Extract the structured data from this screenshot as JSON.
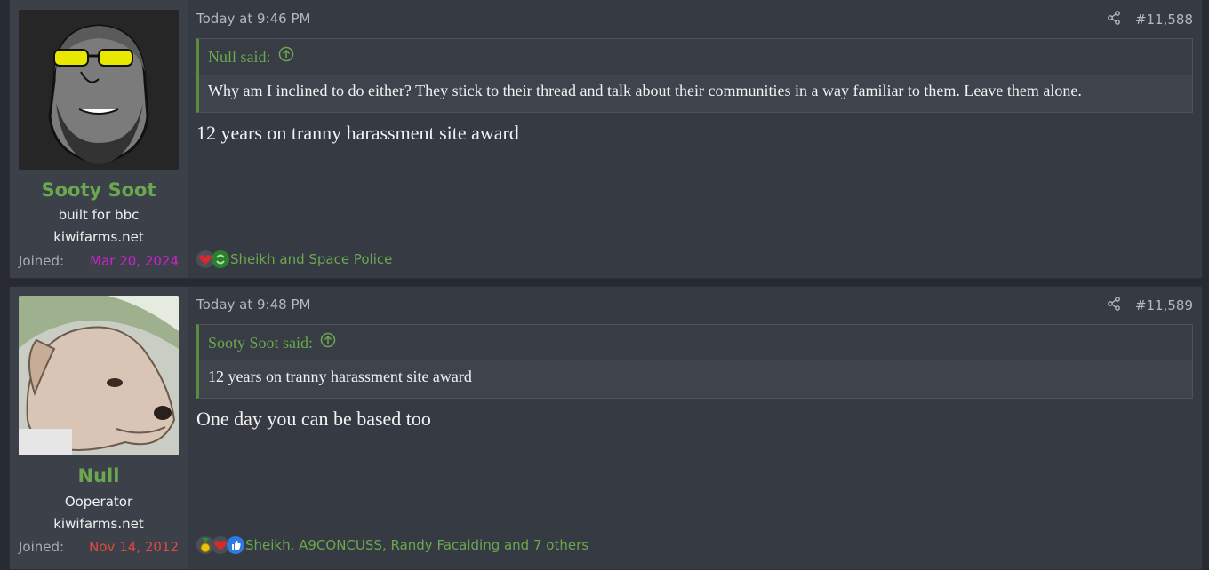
{
  "posts": [
    {
      "username": "Sooty Soot",
      "user_title": "built for bbc",
      "user_site": "kiwifarms.net",
      "joined_label": "Joined:",
      "joined_date": "Mar 20, 2024",
      "joined_color": "#d11fd1",
      "date": "Today at 9:46 PM",
      "post_number": "#11,588",
      "quote_author": "Null said:",
      "quote_text": "Why am I inclined to do either? They stick to their thread and talk about their communities in a way familiar to them. Leave them alone.",
      "body": "12 years on tranny harassment site award",
      "reaction_icons": [
        "heart-reaction-icon",
        "recycle-reaction-icon"
      ],
      "reactions": "Sheikh and Space Police"
    },
    {
      "username": "Null",
      "user_title": "Ooperator",
      "user_site": "kiwifarms.net",
      "joined_label": "Joined:",
      "joined_date": "Nov 14, 2012",
      "joined_color": "#e04a3f",
      "date": "Today at 9:48 PM",
      "post_number": "#11,589",
      "quote_author": "Sooty Soot said:",
      "quote_text": "12 years on tranny harassment site award",
      "body": "One day you can be based too",
      "reaction_icons": [
        "medal-reaction-icon",
        "heart-reaction-icon",
        "thumbs-up-reaction-icon"
      ],
      "reactions": "Sheikh, A9CONCUSS, Randy Facalding and 7 others"
    }
  ]
}
